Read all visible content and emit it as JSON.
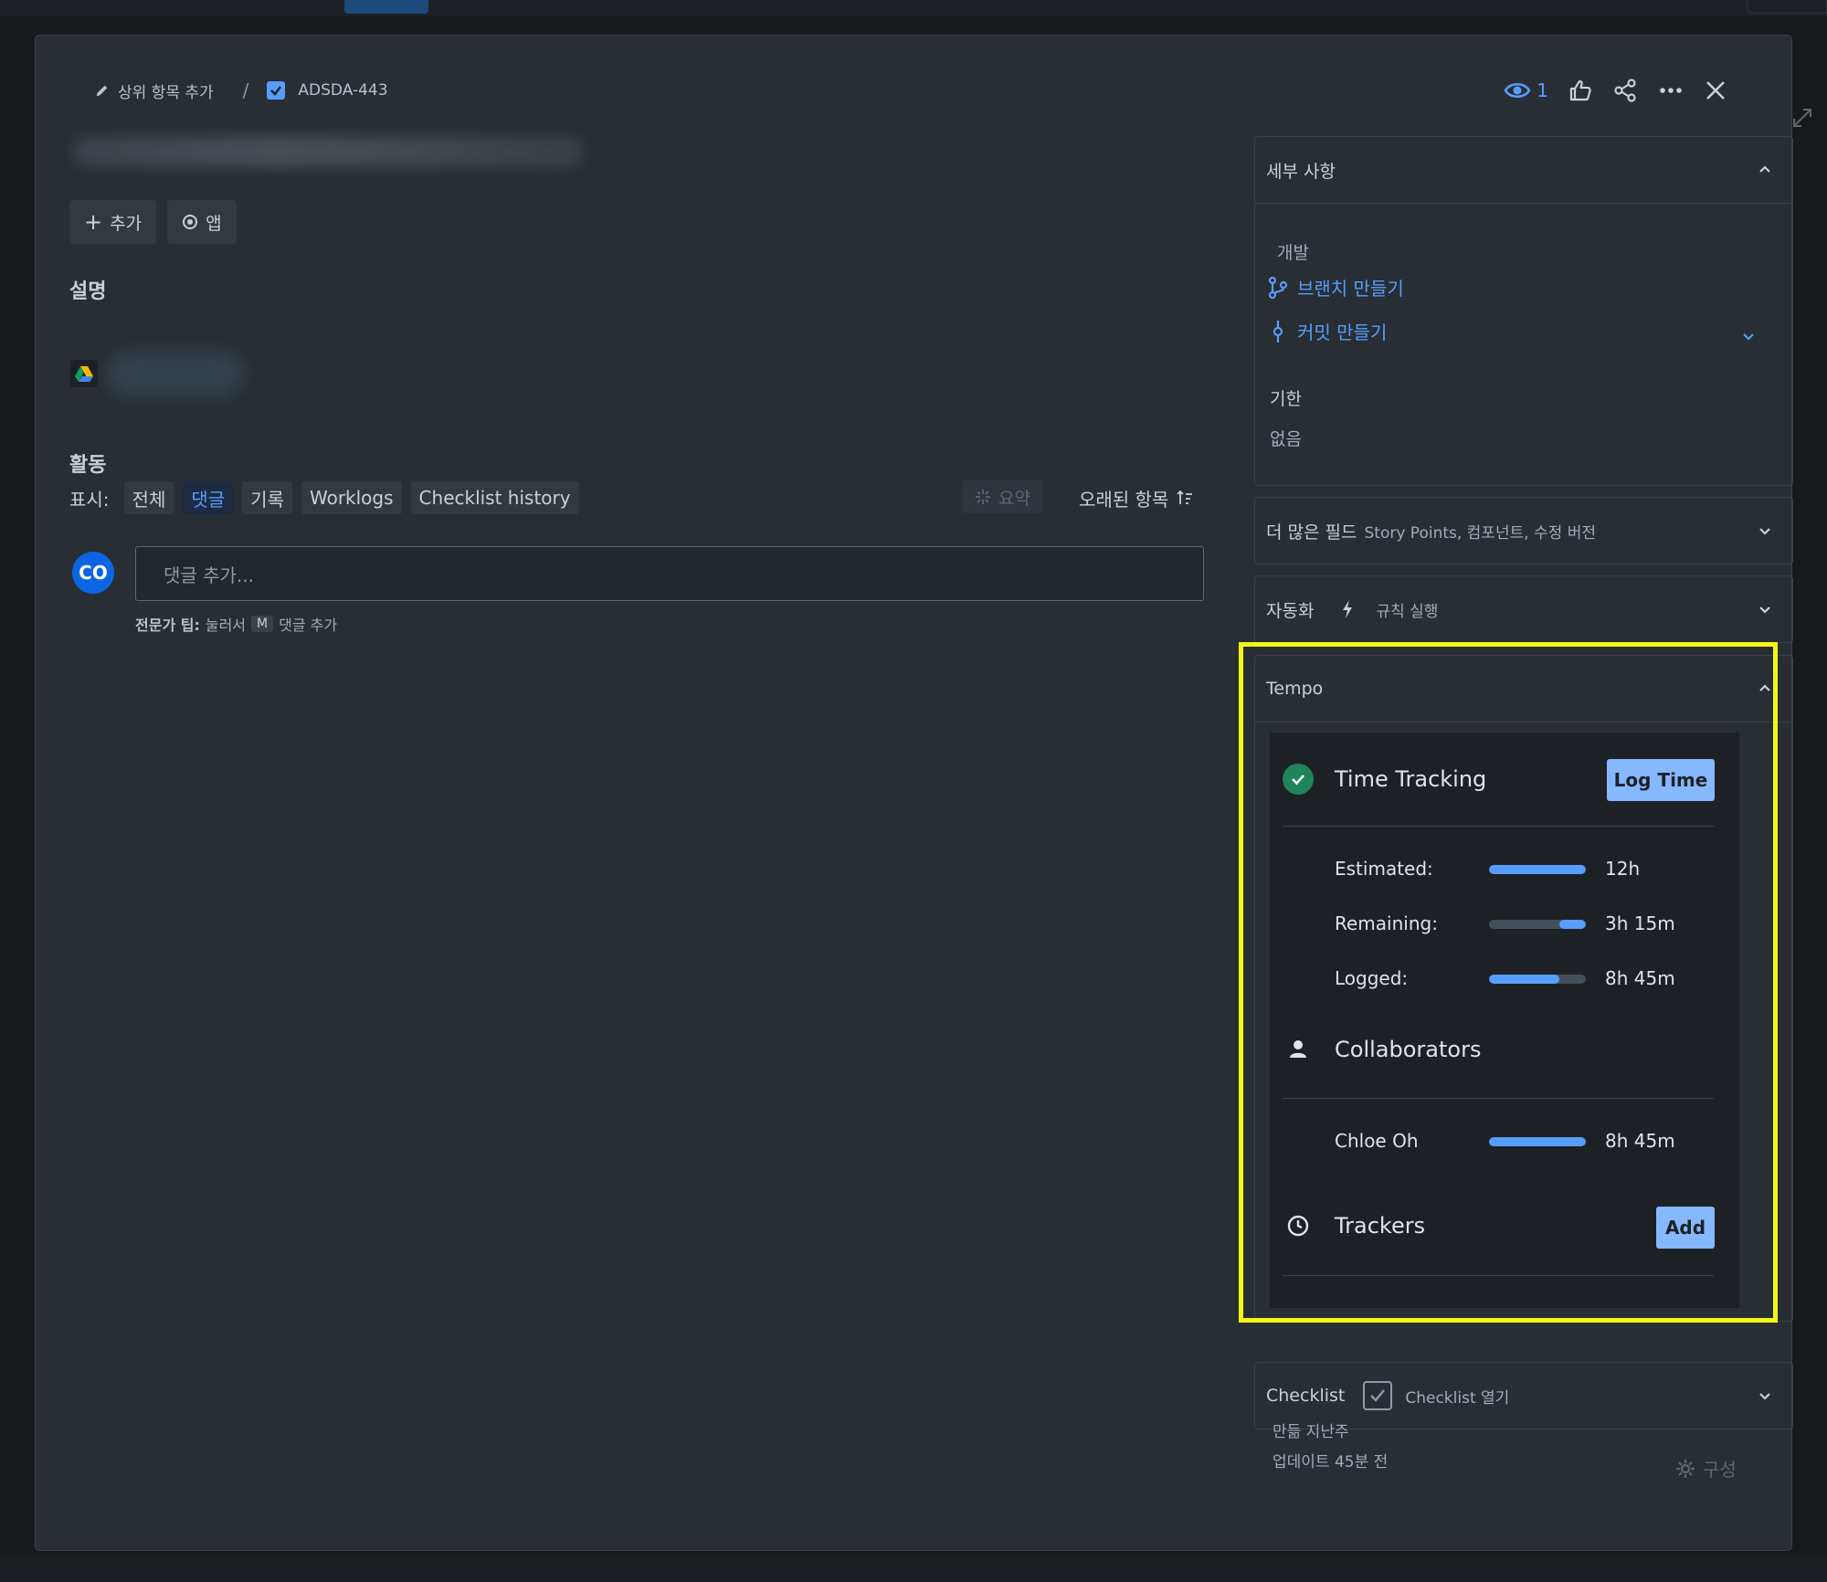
{
  "breadcrumb": {
    "parent_label": "상위 항목 추가",
    "separator": "/",
    "issue_key": "ADSDA-443"
  },
  "top_actions": {
    "watch_count": "1"
  },
  "buttons": {
    "add": "추가",
    "apps": "앱"
  },
  "description_heading": "설명",
  "activity": {
    "heading": "활동",
    "show_label": "표시:",
    "filters": [
      "전체",
      "댓글",
      "기록",
      "Worklogs",
      "Checklist history"
    ],
    "active_filter": "댓글",
    "summary_label": "요약",
    "sort_label": "오래된 항목",
    "comment_placeholder": "댓글 추가...",
    "avatar_initials": "CO",
    "protip_bold": "전문가 팁:",
    "protip_press": "눌러서",
    "protip_key": "M",
    "protip_action": "댓글 추가"
  },
  "details": {
    "heading": "세부 사항",
    "development_label": "개발",
    "create_branch": "브랜치 만들기",
    "create_commit": "커밋 만들기",
    "due_label": "기한",
    "due_value": "없음"
  },
  "more_fields": {
    "heading": "더 많은 필드",
    "subtitle": "Story Points, 컴포넌트, 수정 버전"
  },
  "automation": {
    "heading": "자동화",
    "rule_label": "규칙 실행"
  },
  "tempo": {
    "heading": "Tempo",
    "time_tracking_title": "Time Tracking",
    "log_time_button": "Log Time",
    "stats": [
      {
        "label": "Estimated:",
        "value": "12h",
        "fill_start": 0.0,
        "fill_end": 1.0
      },
      {
        "label": "Remaining:",
        "value": "3h 15m",
        "fill_start": 0.73,
        "fill_end": 1.0
      },
      {
        "label": "Logged:",
        "value": "8h 45m",
        "fill_start": 0.0,
        "fill_end": 0.73
      }
    ],
    "collaborators_title": "Collaborators",
    "collaborators": [
      {
        "name": "Chloe Oh",
        "value": "8h 45m",
        "fill": 1.0
      }
    ],
    "trackers_title": "Trackers",
    "add_button": "Add"
  },
  "checklist": {
    "heading": "Checklist",
    "open_label": "Checklist 열기"
  },
  "footer": {
    "created": "만듦 지난주",
    "updated": "업데이트 45분 전",
    "configure": "구성"
  },
  "colors": {
    "accent_blue": "#579dff",
    "button_blue": "#85b8ff",
    "highlight_yellow": "#f5f516",
    "success_green": "#1f845a",
    "modal_bg": "#282e33"
  }
}
